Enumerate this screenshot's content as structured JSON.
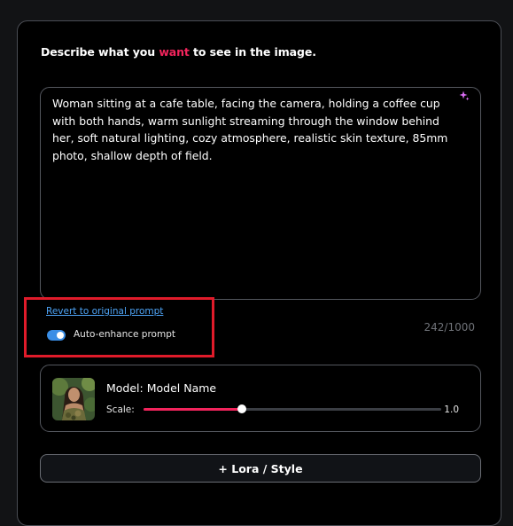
{
  "header": {
    "text_before": "Describe what you ",
    "text_accent": "want",
    "text_after": " to see in the image."
  },
  "prompt": {
    "value": "Woman sitting at a cafe table, facing the camera, holding a coffee cup with both hands, warm sunlight streaming through the window behind her, soft natural lighting, cozy atmosphere, realistic skin texture, 85mm photo, shallow depth of field.",
    "enhance_icon": "sparkle-icon"
  },
  "revert_link": "Revert to original prompt",
  "auto_enhance": {
    "label": "Auto-enhance prompt",
    "enabled": true
  },
  "char_count": "242/1000",
  "model": {
    "name_text": "Model: Model Name",
    "scale_label": "Scale:",
    "scale_value": "1.0",
    "scale_fraction": 0.33
  },
  "lora_button": "+ Lora / Style",
  "colors": {
    "accent": "#f2245c",
    "link": "#4da3f5",
    "toggle_on": "#3a8ee6",
    "highlight": "#e01b2a"
  }
}
